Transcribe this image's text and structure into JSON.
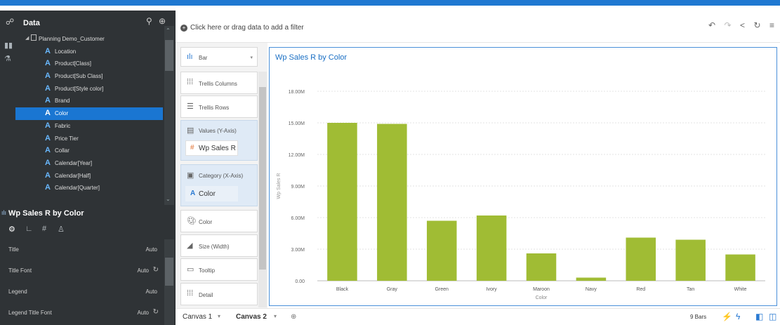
{
  "data_panel": {
    "title": "Data",
    "root": "Planning Demo_Customer",
    "items": [
      "Location",
      "Product[Class]",
      "Product[Sub Class]",
      "Product[Style color]",
      "Brand",
      "Color",
      "Fabric",
      "Price Tier",
      "Collar",
      "Calendar[Year]",
      "Calendar[Half]",
      "Calendar[Quarter]"
    ],
    "selected_index": 5
  },
  "properties": {
    "title": "Wp Sales R by Color",
    "rows": [
      {
        "key": "Title",
        "value": "Auto"
      },
      {
        "key": "Title Font",
        "value": "Auto"
      },
      {
        "key": "Legend",
        "value": "Auto"
      },
      {
        "key": "Legend Title Font",
        "value": "Auto"
      }
    ]
  },
  "filter": {
    "placeholder": "Click here or drag data to add a filter"
  },
  "grammar": {
    "chart_type": "Bar",
    "trellis_columns": "Trellis Columns",
    "trellis_rows": "Trellis Rows",
    "values_label": "Values (Y-Axis)",
    "values_item": "Wp Sales R",
    "category_label": "Category (X-Axis)",
    "category_item": "Color",
    "color": "Color",
    "size": "Size (Width)",
    "tooltip": "Tooltip",
    "detail": "Detail"
  },
  "chart_data": {
    "type": "bar",
    "title": "Wp Sales R by Color",
    "xlabel": "Color",
    "ylabel": "Wp Sales R",
    "categories": [
      "Black",
      "Gray",
      "Green",
      "Ivory",
      "Maroon",
      "Navy",
      "Red",
      "Tan",
      "White"
    ],
    "values": [
      15.0,
      14.9,
      5.7,
      6.2,
      2.6,
      0.3,
      4.1,
      3.9,
      2.5
    ],
    "yticks": [
      "0.00",
      "3.00M",
      "6.00M",
      "9.00M",
      "12.00M",
      "15.00M",
      "18.00M"
    ],
    "ylim": [
      0,
      18
    ],
    "bar_color": "#a0bc34",
    "grid": true
  },
  "bottom": {
    "canvas1": "Canvas 1",
    "canvas2": "Canvas 2",
    "bar_count": "9 Bars"
  },
  "colors": {
    "accent": "#1f78d1",
    "panel_bg": "#2f3336",
    "bar": "#a0bc34"
  }
}
